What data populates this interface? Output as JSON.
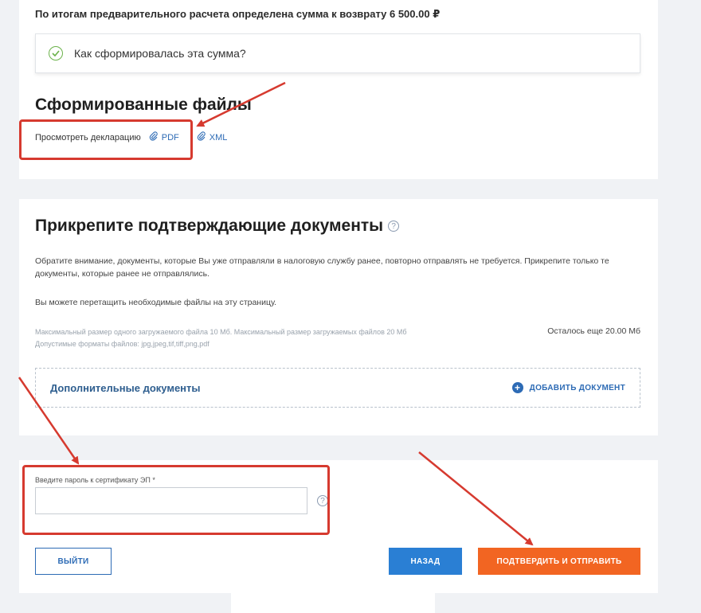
{
  "summary": {
    "text": "По итогам предварительного расчета определена сумма к возврату 6 500.00 ₽",
    "info_link": "Как сформировалась эта сумма?"
  },
  "files": {
    "title": "Сформированные файлы",
    "view_label": "Просмотреть декларацию",
    "pdf": "PDF",
    "xml": "XML"
  },
  "docs": {
    "title": "Прикрепите подтверждающие документы",
    "help": "?",
    "notice": "Обратите внимание, документы, которые Вы уже отправляли в налоговую службу ранее, повторно отправлять не требуется. Прикрепите только те документы, которые ранее не отправлялись.",
    "drag_hint": "Вы можете перетащить необходимые файлы на эту страницу.",
    "max_size": "Максимальный размер одного загружаемого файла 10 Мб. Максимальный размер загружаемых файлов 20 Мб",
    "formats": "Допустимые форматы файлов: jpg,jpeg,tif,tiff,png,pdf",
    "remaining": "Осталось еще 20.00 Мб",
    "additional_label": "Дополнительные документы",
    "add_button": "ДОБАВИТЬ ДОКУМЕНТ"
  },
  "sign": {
    "password_label": "Введите пароль к сертификату ЭП *",
    "password_value": "",
    "help": "?"
  },
  "buttons": {
    "exit": "ВЫЙТИ",
    "back": "НАЗАД",
    "confirm": "ПОДТВЕРДИТЬ И ОТПРАВИТЬ"
  },
  "colors": {
    "accent_blue": "#2a7fd4",
    "confirm_orange": "#f26522",
    "annotation_red": "#d63a2f",
    "check_green": "#6bb24a"
  }
}
